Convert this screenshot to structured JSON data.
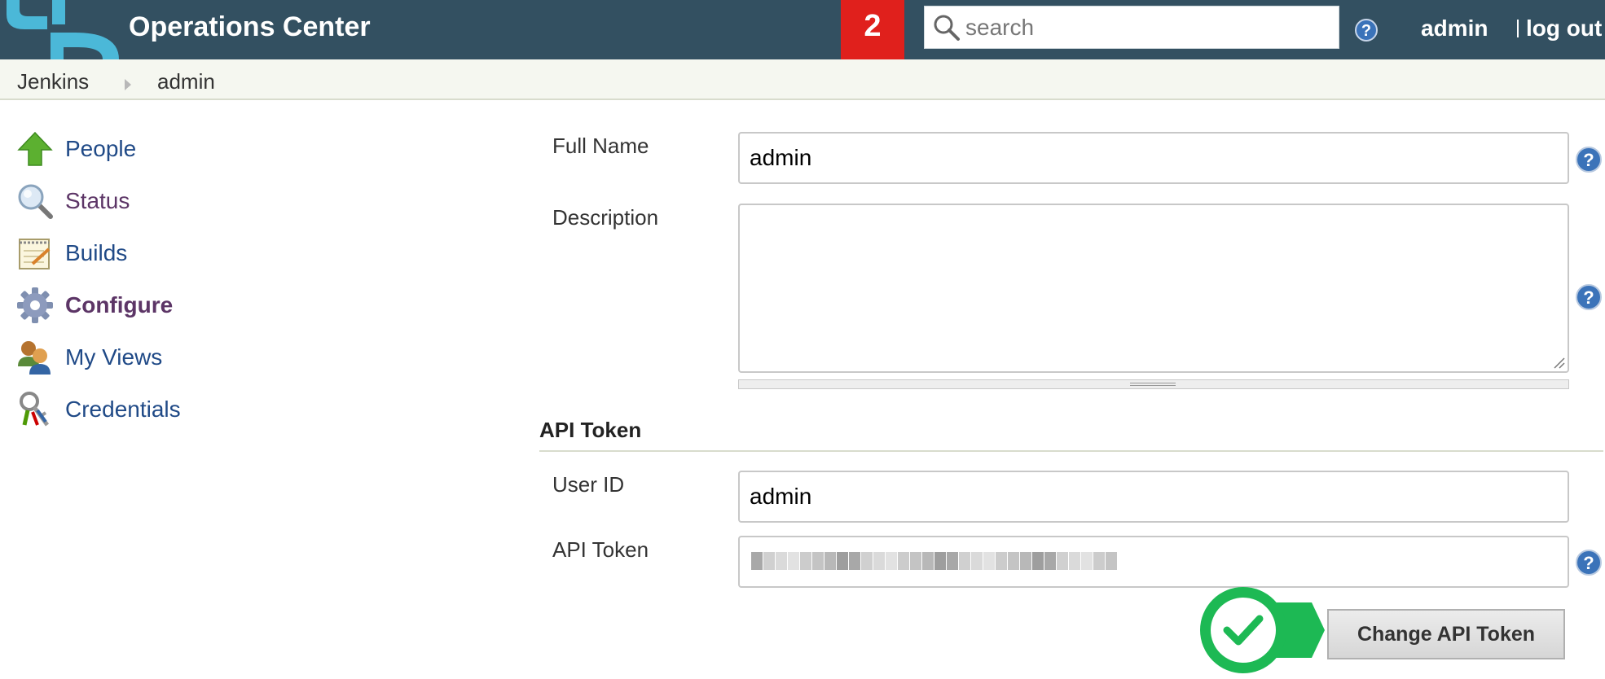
{
  "header": {
    "title": "Operations Center",
    "notification_count": "2",
    "search_placeholder": "search",
    "user": "admin",
    "logout": "log out"
  },
  "breadcrumb": [
    "Jenkins",
    "admin"
  ],
  "sidebar": {
    "items": [
      {
        "label": "People",
        "icon": "up-arrow-icon"
      },
      {
        "label": "Status",
        "icon": "magnifier-icon"
      },
      {
        "label": "Builds",
        "icon": "notepad-icon"
      },
      {
        "label": "Configure",
        "icon": "gear-icon"
      },
      {
        "label": "My Views",
        "icon": "users-icon"
      },
      {
        "label": "Credentials",
        "icon": "keys-icon"
      }
    ]
  },
  "form": {
    "full_name_label": "Full Name",
    "full_name_value": "admin",
    "description_label": "Description",
    "description_value": "",
    "api_section_title": "API Token",
    "user_id_label": "User ID",
    "user_id_value": "admin",
    "api_token_label": "API Token",
    "change_token_button": "Change API Token"
  },
  "colors": {
    "header_bg": "#335061",
    "alert_red": "#e0201c",
    "link_blue": "#204a87",
    "link_visited": "#5c3566",
    "success_green": "#1db954"
  }
}
